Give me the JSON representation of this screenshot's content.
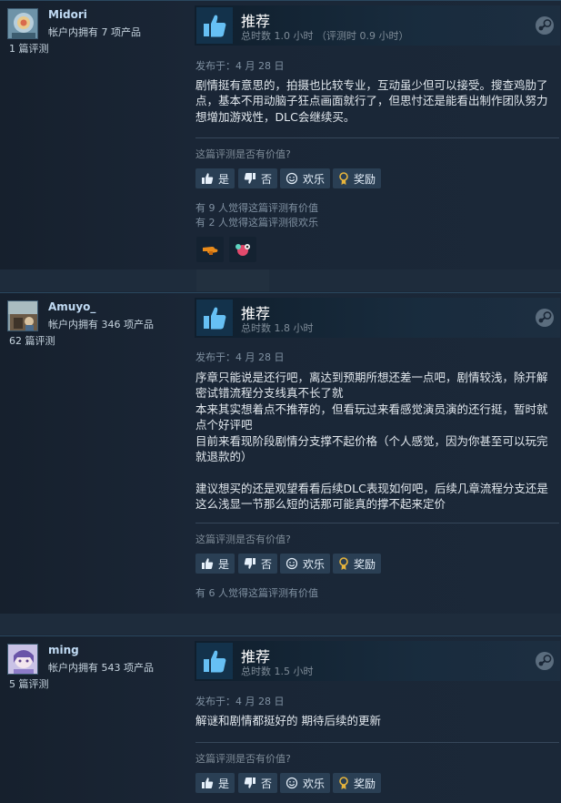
{
  "ui": {
    "helpful_question": "这篇评测是否有价值?",
    "btn_yes": "是",
    "btn_no": "否",
    "btn_funny": "欢乐",
    "btn_award": "奖励",
    "colors": {
      "background": "#1b2838",
      "accent": "#66c0f4",
      "award_gold": "#e6b43c"
    }
  },
  "reviews": [
    {
      "username": "Midori",
      "products": "帐户内拥有 7 项产品",
      "review_count": "1 篇评测",
      "verdict": "推荐",
      "hours": "总时数 1.0 小时 （评测时 0.9 小时）",
      "posted": "发布于：4 月 28 日",
      "body": [
        "剧情挺有意思的，拍摄也比较专业，互动虽少但可以接受。搜查鸡肋了点，基本不用动脑子狂点画面就行了，但思忖还是能看出制作团队努力想增加游戏性，DLC会继续买。"
      ],
      "votes": [
        "有 9 人觉得这篇评测有价值",
        "有 2 人觉得这篇评测很欢乐"
      ],
      "awards": [
        "hand-award-icon",
        "heart-eyes-award-icon"
      ]
    },
    {
      "username": "Amuyo_",
      "products": "帐户内拥有 346 项产品",
      "review_count": "62 篇评测",
      "verdict": "推荐",
      "hours": "总时数 1.8 小时",
      "posted": "发布于：4 月 28 日",
      "body": [
        "序章只能说是还行吧，离达到预期所想还差一点吧，剧情较浅，除开解密试错流程分支线真不长了就",
        "本来其实想着点不推荐的，但看玩过来看感觉演员演的还行挺，暂时就点个好评吧",
        "目前来看现阶段剧情分支撑不起价格（个人感觉，因为你甚至可以玩完就退款的）",
        "",
        "建议想买的还是观望看看后续DLC表现如何吧，后续几章流程分支还是这么浅显一节那么短的话那可能真的撑不起来定价"
      ],
      "votes": [
        "有 6 人觉得这篇评测有价值"
      ],
      "awards": []
    },
    {
      "username": "ming",
      "products": "帐户内拥有 543 项产品",
      "review_count": "5 篇评测",
      "verdict": "推荐",
      "hours": "总时数 1.5 小时",
      "posted": "发布于：4 月 28 日",
      "body": [
        "解谜和剧情都挺好的 期待后续的更新"
      ],
      "votes": [],
      "awards": []
    }
  ]
}
